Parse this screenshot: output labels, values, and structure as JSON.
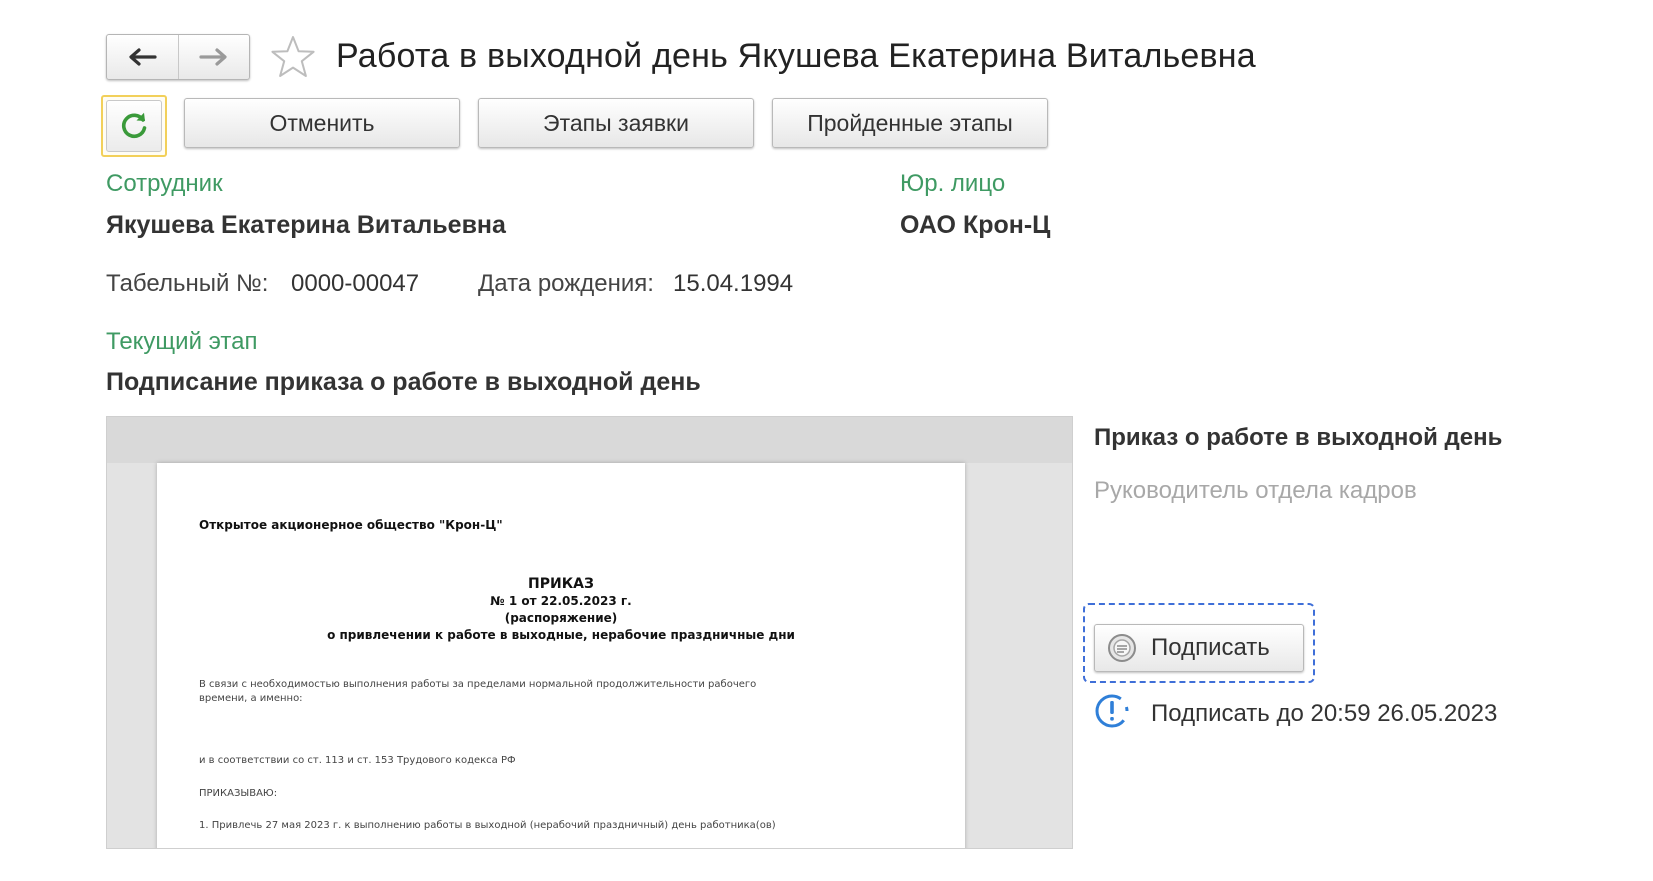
{
  "window": {
    "title": "Работа в выходной день Якушева Екатерина Витальевна"
  },
  "toolbar": {
    "cancel_label": "Отменить",
    "stages_label": "Этапы заявки",
    "passed_stages_label": "Пройденные этапы"
  },
  "employee": {
    "label": "Сотрудник",
    "name": "Якушева Екатерина Витальевна",
    "tab_label": "Табельный №:",
    "tab_value": "0000-00047",
    "birth_label": "Дата рождения:",
    "birth_value": "15.04.1994"
  },
  "legal_entity": {
    "label": "Юр. лицо",
    "value": "ОАО Крон-Ц"
  },
  "stage": {
    "label": "Текущий этап",
    "value": "Подписание приказа о работе в выходной день"
  },
  "document_preview": {
    "org": "Открытое акционерное общество \"Крон-Ц\"",
    "heading": "ПРИКАЗ",
    "number": "№ 1 от 22.05.2023 г.",
    "kind": "(распоряжение)",
    "subject": "о привлечении к работе в выходные, нерабочие праздничные дни",
    "para1_line1": "В связи с необходимостью выполнения работы за пределами нормальной продолжительности рабочего",
    "para1_line2": "времени, а именно:",
    "para2": "и в соответствии со ст. 113 и ст. 153 Трудового кодекса РФ",
    "order": "ПРИКАЗЫВАЮ:",
    "item1": "1. Привлечь 27 мая 2023 г. к выполнению работы в выходной (нерабочий праздничный) день  работника(ов)"
  },
  "signing": {
    "doc_title": "Приказ о работе в выходной день",
    "role": "Руководитель отдела кадров",
    "sign_button": "Подписать",
    "deadline": "Подписать до 20:59 26.05.2023"
  },
  "colors": {
    "green_label": "#3f9a63",
    "focus_yellow": "#f2d05a",
    "focus_blue": "#3f6fd8",
    "refresh_green": "#3a9a3a",
    "warning_blue": "#2f7fd8"
  },
  "icons": [
    "back-arrow-icon",
    "forward-arrow-icon",
    "star-icon",
    "refresh-icon",
    "sign-icon",
    "warning-icon"
  ]
}
